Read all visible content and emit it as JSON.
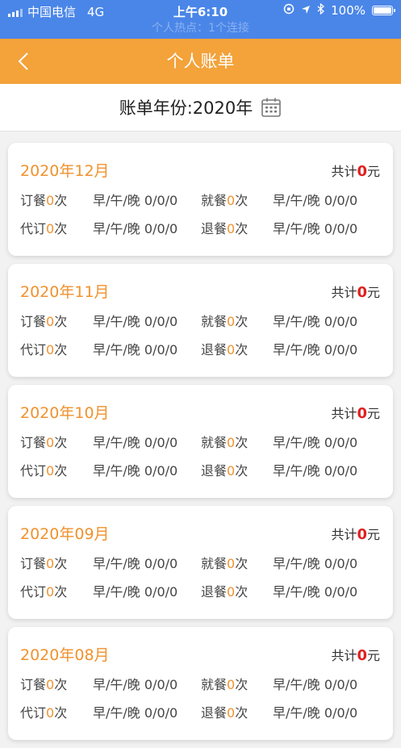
{
  "status_bar": {
    "carrier": "中国电信",
    "network": "4G",
    "time": "上午6:10",
    "battery": "100%",
    "battery_level": 1.0,
    "hotspot_text": "个人热点：1个连接"
  },
  "nav": {
    "title": "个人账单",
    "back_icon": "chevron-left-icon"
  },
  "year_selector": {
    "label": "账单年份:2020年",
    "icon": "calendar-icon"
  },
  "labels": {
    "total_prefix": "共计",
    "total_suffix": "元",
    "order": "订餐",
    "proxy_order": "代订",
    "dine": "就餐",
    "cancel": "退餐",
    "count_unit": "次",
    "meals": "早/午/晚"
  },
  "months": [
    {
      "month": "2020年12月",
      "total": "0",
      "order_count": "0",
      "order_meals": "0/0/0",
      "dine_count": "0",
      "dine_meals": "0/0/0",
      "proxy_count": "0",
      "proxy_meals": "0/0/0",
      "cancel_count": "0",
      "cancel_meals": "0/0/0"
    },
    {
      "month": "2020年11月",
      "total": "0",
      "order_count": "0",
      "order_meals": "0/0/0",
      "dine_count": "0",
      "dine_meals": "0/0/0",
      "proxy_count": "0",
      "proxy_meals": "0/0/0",
      "cancel_count": "0",
      "cancel_meals": "0/0/0"
    },
    {
      "month": "2020年10月",
      "total": "0",
      "order_count": "0",
      "order_meals": "0/0/0",
      "dine_count": "0",
      "dine_meals": "0/0/0",
      "proxy_count": "0",
      "proxy_meals": "0/0/0",
      "cancel_count": "0",
      "cancel_meals": "0/0/0"
    },
    {
      "month": "2020年09月",
      "total": "0",
      "order_count": "0",
      "order_meals": "0/0/0",
      "dine_count": "0",
      "dine_meals": "0/0/0",
      "proxy_count": "0",
      "proxy_meals": "0/0/0",
      "cancel_count": "0",
      "cancel_meals": "0/0/0"
    },
    {
      "month": "2020年08月",
      "total": "0",
      "order_count": "0",
      "order_meals": "0/0/0",
      "dine_count": "0",
      "dine_meals": "0/0/0",
      "proxy_count": "0",
      "proxy_meals": "0/0/0",
      "cancel_count": "0",
      "cancel_meals": "0/0/0"
    }
  ],
  "colors": {
    "status_bar": "#4a86e8",
    "nav_bar": "#f4a23a",
    "accent": "#f0922e",
    "total_red": "#e02020"
  }
}
